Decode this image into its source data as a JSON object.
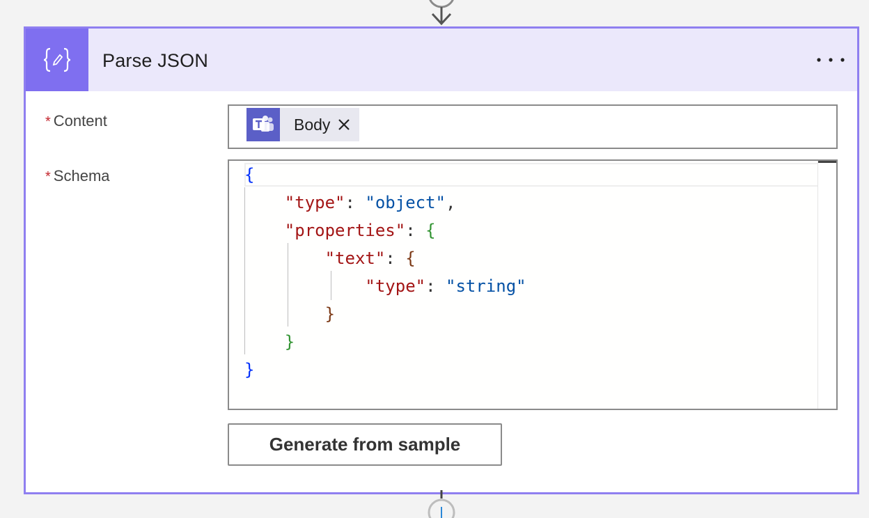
{
  "action": {
    "title": "Parse JSON",
    "icon": "curly-braces-pencil-icon",
    "more_icon": "ellipsis-icon"
  },
  "fields": {
    "content": {
      "required_marker": "*",
      "label": "Content",
      "token": {
        "icon": "microsoft-teams-icon",
        "label": "Body",
        "remove_icon": "close-icon"
      }
    },
    "schema": {
      "required_marker": "*",
      "label": "Schema",
      "code": {
        "l1_brace": "{",
        "l2_key": "\"type\"",
        "l2_colon": ": ",
        "l2_value": "\"object\"",
        "l2_comma": ",",
        "l3_key": "\"properties\"",
        "l3_colon": ": ",
        "l3_brace": "{",
        "l4_key": "\"text\"",
        "l4_colon": ": ",
        "l4_brace": "{",
        "l5_key": "\"type\"",
        "l5_colon": ": ",
        "l5_value": "\"string\"",
        "l6_brace": "}",
        "l7_brace": "}",
        "l8_brace": "}"
      }
    }
  },
  "buttons": {
    "generate_label": "Generate from sample"
  },
  "colors": {
    "accent": "#8f7ff0",
    "header_bg": "#ebe8fb",
    "icon_bg": "#7f6ff0",
    "teams": "#5b5fc7",
    "required": "#c4262e"
  }
}
